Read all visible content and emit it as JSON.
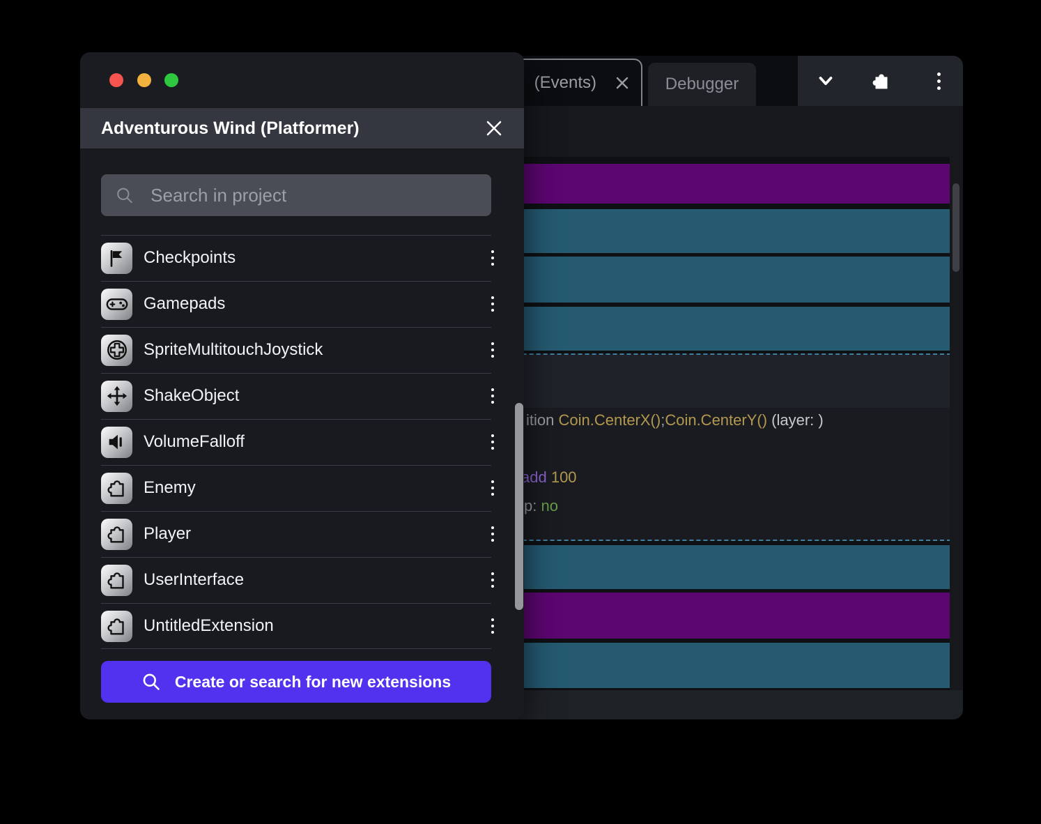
{
  "dialog": {
    "title": "Adventurous Wind (Platformer)",
    "search_placeholder": "Search in project",
    "items": [
      {
        "label": "Checkpoints",
        "icon": "flag-icon"
      },
      {
        "label": "Gamepads",
        "icon": "gamepad-icon"
      },
      {
        "label": "SpriteMultitouchJoystick",
        "icon": "joystick-icon"
      },
      {
        "label": "ShakeObject",
        "icon": "move-arrows-icon"
      },
      {
        "label": "VolumeFalloff",
        "icon": "speaker-icon"
      },
      {
        "label": "Enemy",
        "icon": "puzzle-icon"
      },
      {
        "label": "Player",
        "icon": "puzzle-icon"
      },
      {
        "label": "UserInterface",
        "icon": "puzzle-icon"
      },
      {
        "label": "UntitledExtension",
        "icon": "puzzle-icon"
      }
    ],
    "cta_label": "Create or search for new extensions"
  },
  "editor": {
    "tabs": {
      "events": "(Events)",
      "debugger": "Debugger"
    },
    "code": {
      "line1_pre": "ition ",
      "line1_fn1": "Coin.CenterX()",
      "line1_sep": ";",
      "line1_fn2": "Coin.CenterY()",
      "line1_suffix": " (layer: )",
      "line2_kw": "add ",
      "line2_num": "100",
      "line3_label": "p: ",
      "line3_val": "no"
    }
  },
  "colors": {
    "accent_purple": "#5232ef",
    "event_purple": "#5c0672",
    "event_teal": "#255a71",
    "selection_dash": "#3f7fa0"
  }
}
